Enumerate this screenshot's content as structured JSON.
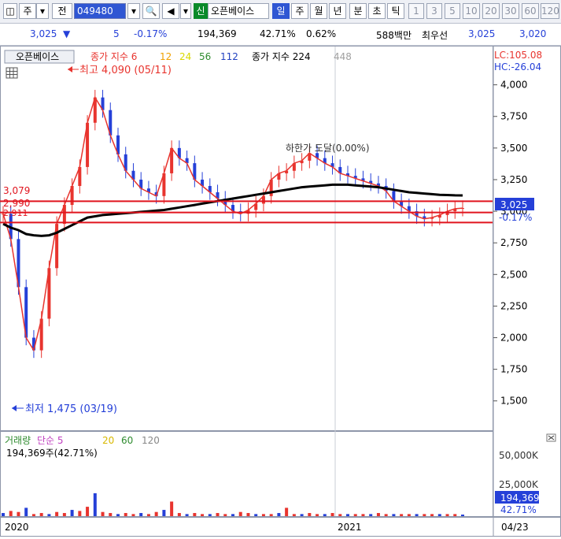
{
  "toolbar": {
    "type_label": "주",
    "prev_label": "전",
    "code": "049480",
    "new_badge": "신",
    "stock_name": "오픈베이스",
    "periods": [
      "일",
      "주",
      "월",
      "년",
      "분",
      "초",
      "틱"
    ],
    "active_period": "일",
    "intervals": [
      "1",
      "3",
      "5",
      "10",
      "20",
      "30",
      "60",
      "120"
    ]
  },
  "quote": {
    "price": "3,025",
    "direction": "▼",
    "change": "5",
    "change_pct": "-0.17%",
    "volume": "194,369",
    "volume_ratio": "42.71%",
    "turnover_pct": "0.62%",
    "amount": "588백만",
    "best_ask_label": "최우선",
    "best_ask": "3,025",
    "best_bid": "3,020"
  },
  "legend": {
    "stock_name": "오픈베이스",
    "ma_label": "종가 지수 6",
    "ma_periods": [
      "12",
      "24",
      "56",
      "112"
    ],
    "ma_label_2": "종가 지수 224",
    "ma_period_2": "448",
    "lc": "LC:105.08",
    "hc": "HC:-26.04"
  },
  "annotations": {
    "high": "최고 4,090 (05/11)",
    "low": "최저 1,475 (03/19)",
    "limit_down": "하한가 도달(0.00%)",
    "line_3079": "3,079",
    "line_2990": "2,990",
    "line_2911": "2,911"
  },
  "price_axis": {
    "ticks": [
      "4,000",
      "3,750",
      "3,500",
      "3,250",
      "3,000",
      "2,750",
      "2,500",
      "2,250",
      "2,000",
      "1,750",
      "1,500"
    ],
    "current_price": "3,025",
    "current_change": "-0.17%"
  },
  "volume_panel": {
    "title": "거래량",
    "ma_label": "단순 5",
    "ma_periods": [
      "20",
      "60",
      "120"
    ],
    "current": "194,369주(42.71%)",
    "axis_ticks": [
      "50,000K",
      "25,000K"
    ],
    "current_box": "194,369",
    "current_pct": "42.71%"
  },
  "time_axis": {
    "labels": [
      "2020",
      "2021"
    ],
    "last_date": "04/23"
  },
  "colors": {
    "up": "#e8342e",
    "down": "#2540d8",
    "ma6": "#e8342e",
    "ma12": "#f0a000",
    "ma24": "#e8e800",
    "ma56": "#2e8b2e",
    "ma112": "#2040c0",
    "ma224": "#000000",
    "ma448": "#a0a0a0",
    "hline": "#e0141e",
    "background": "#ffffff",
    "axis_bg": "#ffffff"
  },
  "chart_data": {
    "type": "candlestick",
    "price_axis_range": [
      1380,
      4060
    ],
    "volume_axis_range": [
      0,
      62000000
    ],
    "horizontal_lines": [
      3079,
      2990,
      2911
    ],
    "high_marker": {
      "value": 4090,
      "date": "05/11"
    },
    "low_marker": {
      "value": 1475,
      "date": "03/19"
    },
    "moving_averages": [
      {
        "period": 6,
        "color": "#e8342e",
        "values": [
          2980,
          2780,
          2400,
          2000,
          1900,
          2150,
          2550,
          2900,
          3050,
          3200,
          3350,
          3700,
          3900,
          3800,
          3600,
          3450,
          3320,
          3250,
          3180,
          3150,
          3120,
          3300,
          3500,
          3420,
          3380,
          3250,
          3200,
          3150,
          3100,
          3050,
          3000,
          2980,
          3010,
          3060,
          3120,
          3250,
          3300,
          3320,
          3380,
          3400,
          3460,
          3420,
          3380,
          3350,
          3300,
          3280,
          3260,
          3240,
          3220,
          3200,
          3160,
          3080,
          3040,
          3000,
          2960,
          2940,
          2950,
          2970,
          3000,
          3020,
          3025
        ]
      },
      {
        "period": 224,
        "color": "#000000",
        "values": [
          2900,
          2870,
          2850,
          2820,
          2810,
          2805,
          2810,
          2830,
          2860,
          2890,
          2920,
          2950,
          2960,
          2970,
          2975,
          2980,
          2985,
          2990,
          2995,
          3000,
          3005,
          3010,
          3020,
          3030,
          3040,
          3050,
          3060,
          3070,
          3080,
          3090,
          3100,
          3110,
          3120,
          3130,
          3140,
          3150,
          3160,
          3170,
          3180,
          3190,
          3195,
          3200,
          3205,
          3210,
          3210,
          3210,
          3205,
          3200,
          3195,
          3190,
          3180,
          3170,
          3160,
          3150,
          3145,
          3140,
          3135,
          3130,
          3128,
          3126,
          3125
        ]
      }
    ],
    "volume": {
      "series": [
        {
          "name": "거래량",
          "values": [
            3,
            5,
            4,
            8,
            2,
            3,
            2,
            4,
            3,
            6,
            5,
            9,
            22,
            4,
            3,
            2,
            3,
            2,
            3,
            2,
            4,
            6,
            14,
            3,
            2,
            3,
            2,
            2,
            3,
            2,
            2,
            4,
            3,
            2,
            2,
            2,
            3,
            8,
            2,
            2,
            3,
            2,
            2,
            3,
            2,
            2,
            2,
            2,
            2,
            3,
            2,
            2,
            2,
            2,
            2,
            2,
            2,
            2,
            2,
            2,
            1.5
          ]
        }
      ]
    }
  }
}
